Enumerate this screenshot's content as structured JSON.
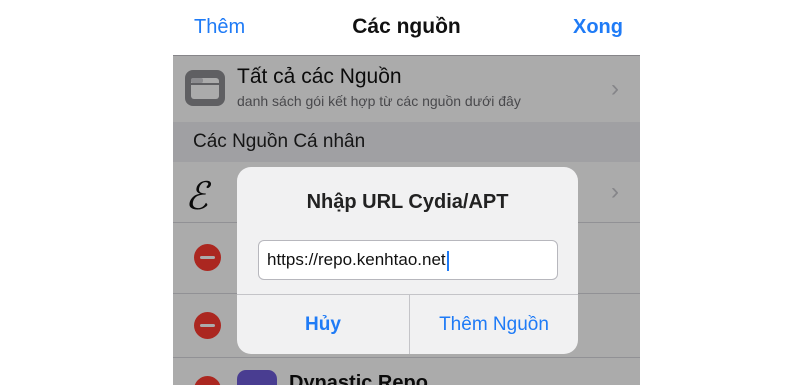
{
  "navbar": {
    "left": "Thêm",
    "title": "Các nguồn",
    "right": "Xong"
  },
  "all_sources": {
    "title": "Tất cả các Nguồn",
    "subtitle": "danh sách gói kết hợp từ các nguồn dưới đây"
  },
  "section": {
    "title": "Các Nguồn Cá nhân"
  },
  "rows": {
    "repo_glyph": "ℰ",
    "last_repo_name": "Dynastic Repo"
  },
  "dialog": {
    "title": "Nhập URL Cydia/APT",
    "input_value": "https://repo.kenhtao.net",
    "cancel": "Hủy",
    "add": "Thêm Nguồn"
  },
  "colors": {
    "accent": "#1f7bf6",
    "delete": "#ff3b30",
    "dim_overlay": "rgba(0,0,0,0.33)"
  },
  "icons": [
    "folder-icon",
    "chevron-right-icon",
    "minus-circle-icon",
    "repo-icon"
  ]
}
